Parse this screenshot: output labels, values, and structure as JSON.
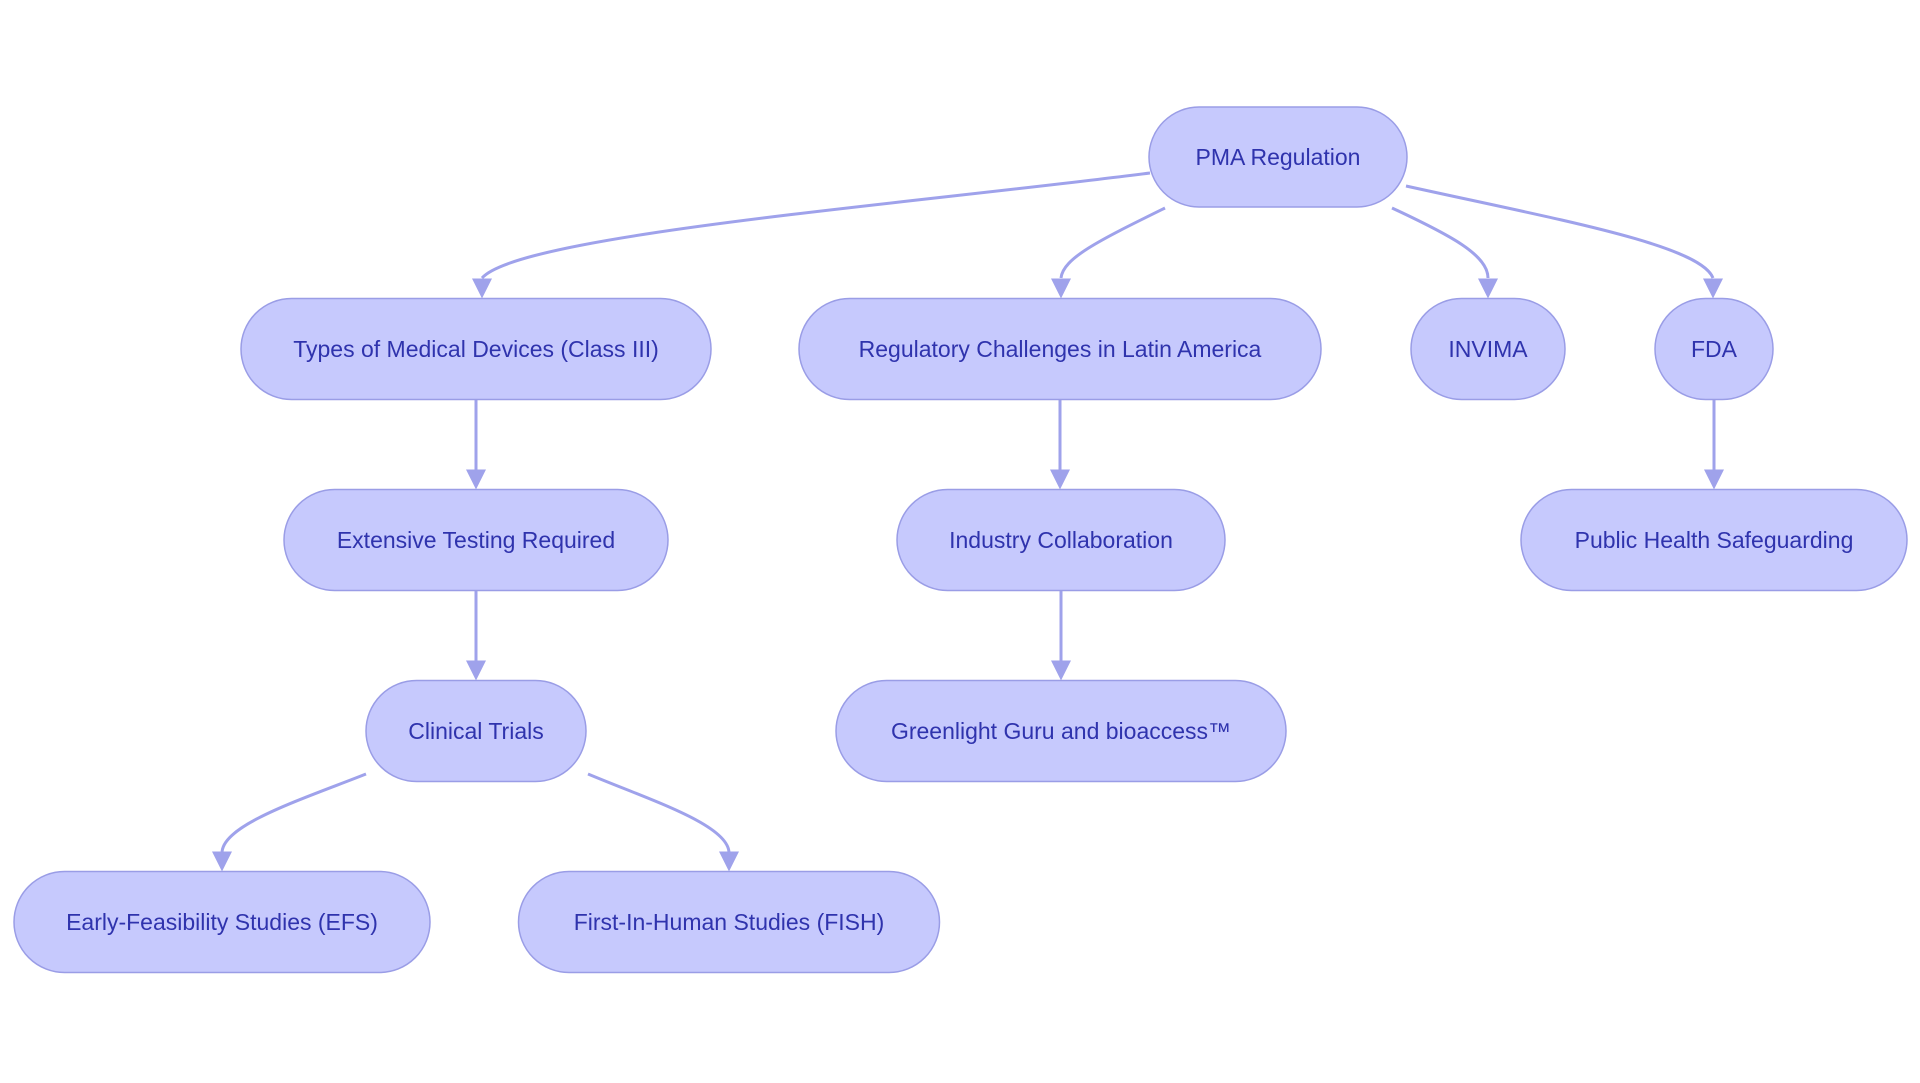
{
  "diagram": {
    "type": "flowchart",
    "colors": {
      "node_fill": "#c6c9fd",
      "node_border": "#9a9de6",
      "edge": "#9fa2eb",
      "text": "#2f33ad",
      "background": "#ffffff"
    },
    "nodes": [
      {
        "id": "pma",
        "label": "PMA Regulation"
      },
      {
        "id": "types",
        "label": "Types of Medical Devices (Class III)"
      },
      {
        "id": "regulatory",
        "label": "Regulatory Challenges in Latin America"
      },
      {
        "id": "invima",
        "label": "INVIMA"
      },
      {
        "id": "fda",
        "label": "FDA"
      },
      {
        "id": "testing",
        "label": "Extensive Testing Required"
      },
      {
        "id": "industry",
        "label": "Industry Collaboration"
      },
      {
        "id": "public",
        "label": "Public Health Safeguarding"
      },
      {
        "id": "clinical",
        "label": "Clinical Trials"
      },
      {
        "id": "greenlight",
        "label": "Greenlight Guru and bioaccess™"
      },
      {
        "id": "efs",
        "label": "Early-Feasibility Studies (EFS)"
      },
      {
        "id": "fish",
        "label": "First-In-Human Studies (FISH)"
      }
    ],
    "edges": [
      {
        "from": "pma",
        "to": "types"
      },
      {
        "from": "pma",
        "to": "regulatory"
      },
      {
        "from": "pma",
        "to": "invima"
      },
      {
        "from": "pma",
        "to": "fda"
      },
      {
        "from": "types",
        "to": "testing"
      },
      {
        "from": "testing",
        "to": "clinical"
      },
      {
        "from": "clinical",
        "to": "efs"
      },
      {
        "from": "clinical",
        "to": "fish"
      },
      {
        "from": "regulatory",
        "to": "industry"
      },
      {
        "from": "industry",
        "to": "greenlight"
      },
      {
        "from": "fda",
        "to": "public"
      }
    ]
  }
}
